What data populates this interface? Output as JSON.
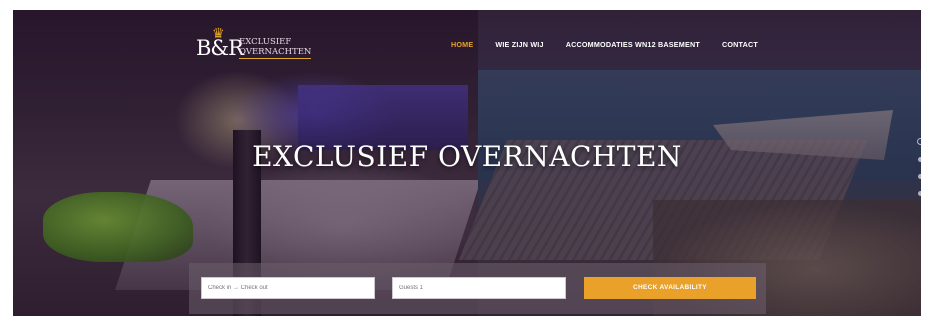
{
  "brand": {
    "mark": "B&R",
    "name_line1": "EXCLUSIEF",
    "name_line2": "OVERNACHTEN",
    "crown_icon": "crown-icon",
    "accent_color": "#e8a326"
  },
  "nav": {
    "items": [
      {
        "label": "HOME",
        "active": true
      },
      {
        "label": "WIE ZIJN WIJ",
        "active": false
      },
      {
        "label": "ACCOMMODATIES WN12 BASEMENT",
        "active": false
      },
      {
        "label": "CONTACT",
        "active": false
      }
    ]
  },
  "hero": {
    "headline": "EXCLUSIEF OVERNACHTEN",
    "slides": {
      "count": 4,
      "current": 1
    }
  },
  "booking": {
    "dates_placeholder": "Check in → Check out",
    "guests_placeholder": "Guests 1",
    "button_label": "CHECK AVAILABILITY",
    "button_color": "#e9a12a"
  }
}
